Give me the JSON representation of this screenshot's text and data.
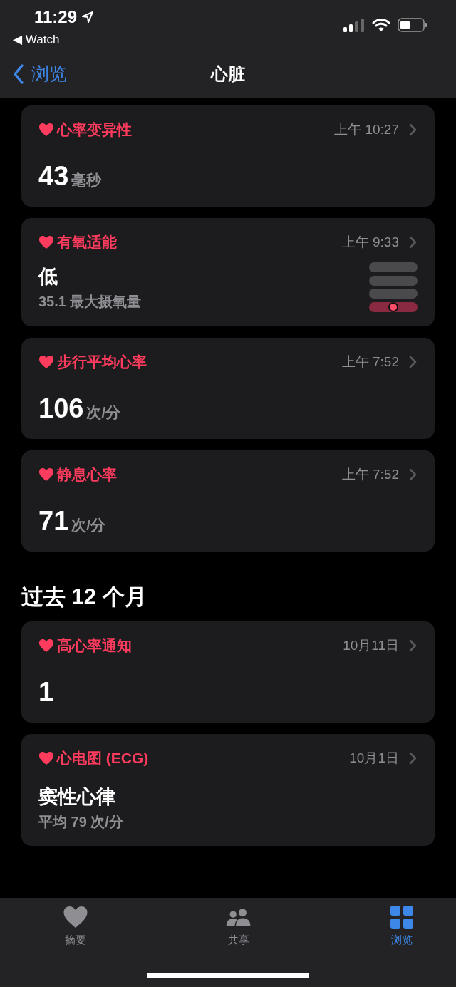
{
  "status_bar": {
    "time": "11:29",
    "back_app": "◀ Watch"
  },
  "nav": {
    "back": "浏览",
    "title": "心脏"
  },
  "sections": [
    {
      "cards": [
        {
          "kind": "quantity",
          "title": "心率变异性",
          "time": "上午 10:27",
          "value": "43",
          "unit": "毫秒"
        },
        {
          "kind": "meter",
          "title": "有氧适能",
          "time": "上午 9:33",
          "value": "低",
          "detail": "35.1 最大摄氧量",
          "segments": [
            {
              "selected": false
            },
            {
              "selected": false
            },
            {
              "selected": false
            },
            {
              "selected": true
            }
          ]
        },
        {
          "kind": "quantity",
          "title": "步行平均心率",
          "time": "上午 7:52",
          "value": "106",
          "unit": "次/分"
        },
        {
          "kind": "quantity",
          "title": "静息心率",
          "time": "上午 7:52",
          "value": "71",
          "unit": "次/分"
        }
      ]
    },
    {
      "heading": "过去 12 个月",
      "cards": [
        {
          "kind": "quantity",
          "title": "高心率通知",
          "time": "10月11日",
          "value": "1"
        },
        {
          "kind": "text",
          "title": "心电图 (ECG)",
          "time": "10月1日",
          "value": "窦性心律",
          "detail": "平均 79 次/分"
        }
      ]
    }
  ],
  "tab_bar": [
    {
      "kind": "summary",
      "label": "摘要",
      "selected": false
    },
    {
      "kind": "sharing",
      "label": "共享",
      "selected": false
    },
    {
      "kind": "browse",
      "label": "浏览",
      "selected": true
    }
  ]
}
